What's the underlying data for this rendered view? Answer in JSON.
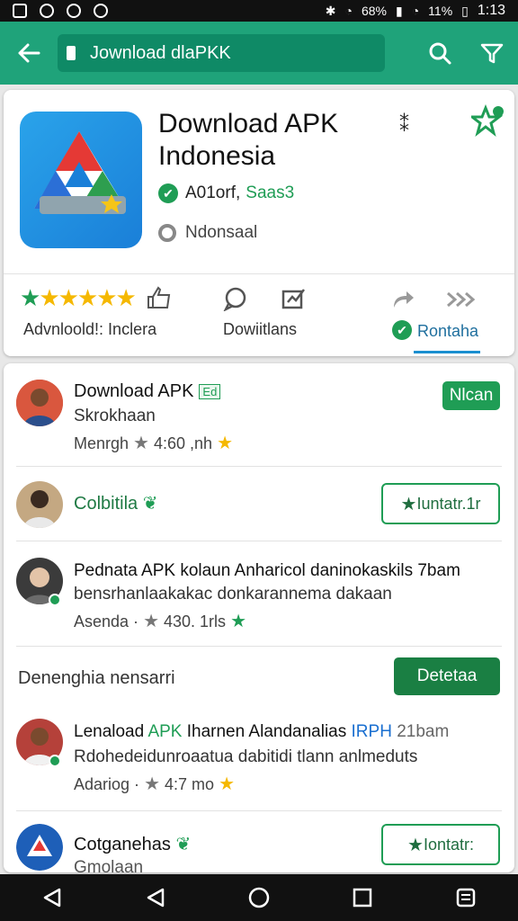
{
  "status_bar": {
    "battery_1": "68%",
    "battery_2": "11%",
    "time": "1:13"
  },
  "header": {
    "search_text": "Jownload dlaPKK"
  },
  "app": {
    "title": "Download APK Indonesia",
    "developer": "A01orf,",
    "developer_sub": "Saas3",
    "region": "Ndonsaal",
    "stats": [
      {
        "label": "Advnloold!: Inclera"
      },
      {
        "label": "Dowiitlans"
      },
      {
        "label": "Rontaha"
      }
    ]
  },
  "list": [
    {
      "title": "Download APK",
      "tag": "Ed",
      "subtitle": "Skrokhaan",
      "meta": "Menrgh",
      "meta_value": "4:60 ,nh",
      "button": "Nlcan"
    },
    {
      "title": "Colbitila",
      "button": "Iuntatr.1r"
    },
    {
      "title": "Pednata APK kolaun Anharicol daninokaskils 7bam",
      "subtitle": "bensrhanlaakakac donkarannema dakaan",
      "meta": "Asenda ·",
      "meta_value": "430. 1rls"
    },
    {
      "section_label": "Denenghia nensarri",
      "button": "Detetaa"
    },
    {
      "title_prefix": "Lenaload",
      "title_green": "APK",
      "title_rest": "Iharnen Alandanalias",
      "title_blue": "IRPH",
      "title_end": "21bam",
      "subtitle": "Rdohedeidunroaatua dabitidi tlann anlmeduts",
      "meta": "Adariog ·",
      "meta_value": "4:7 mo"
    },
    {
      "title": "Cotganehas",
      "subtitle": "Gmolaan",
      "button": "Iontatr:"
    }
  ]
}
